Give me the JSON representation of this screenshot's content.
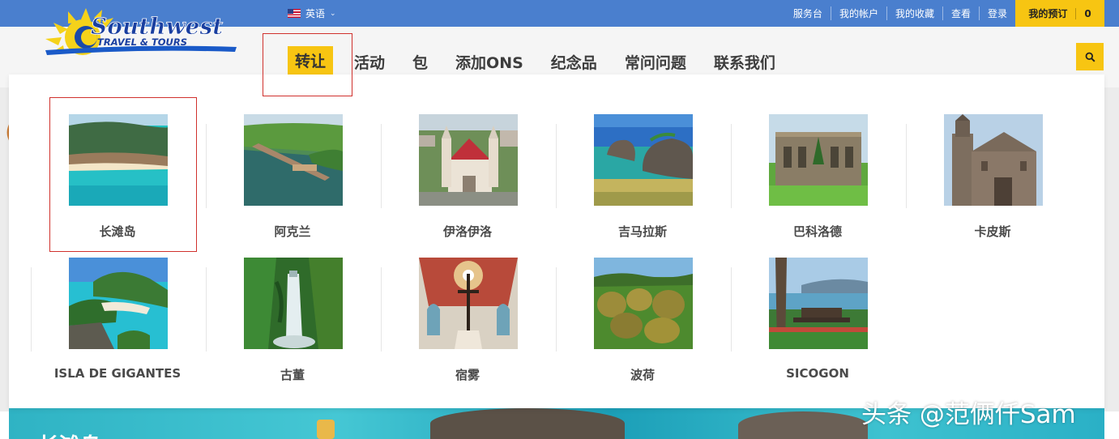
{
  "topbar": {
    "language": "英语",
    "links": [
      "服务台",
      "我的帐户",
      "我的收藏",
      "查看",
      "登录"
    ],
    "booking_label": "我的预订",
    "booking_count": "0"
  },
  "brand": {
    "logo_main": "Southwest",
    "logo_sub": "TRAVEL & TOURS"
  },
  "nav": {
    "items": [
      "转让",
      "活动",
      "包",
      "添加ONS",
      "纪念品",
      "常问问题",
      "联系我们"
    ],
    "active_index": 0
  },
  "menu": {
    "destinations": [
      "长滩岛",
      "阿克兰",
      "伊洛伊洛",
      "吉马拉斯",
      "巴科洛德",
      "卡皮斯",
      "ISLA DE GIGANTES",
      "古董",
      "宿雾",
      "波荷",
      "SICOGON"
    ]
  },
  "hero": {
    "title_partial": "长滩岛"
  },
  "watermark": "头条 @范俩仟Sam",
  "colors": {
    "accent": "#f7c512",
    "topbar": "#4a7fce",
    "highlight": "#d0312d"
  }
}
